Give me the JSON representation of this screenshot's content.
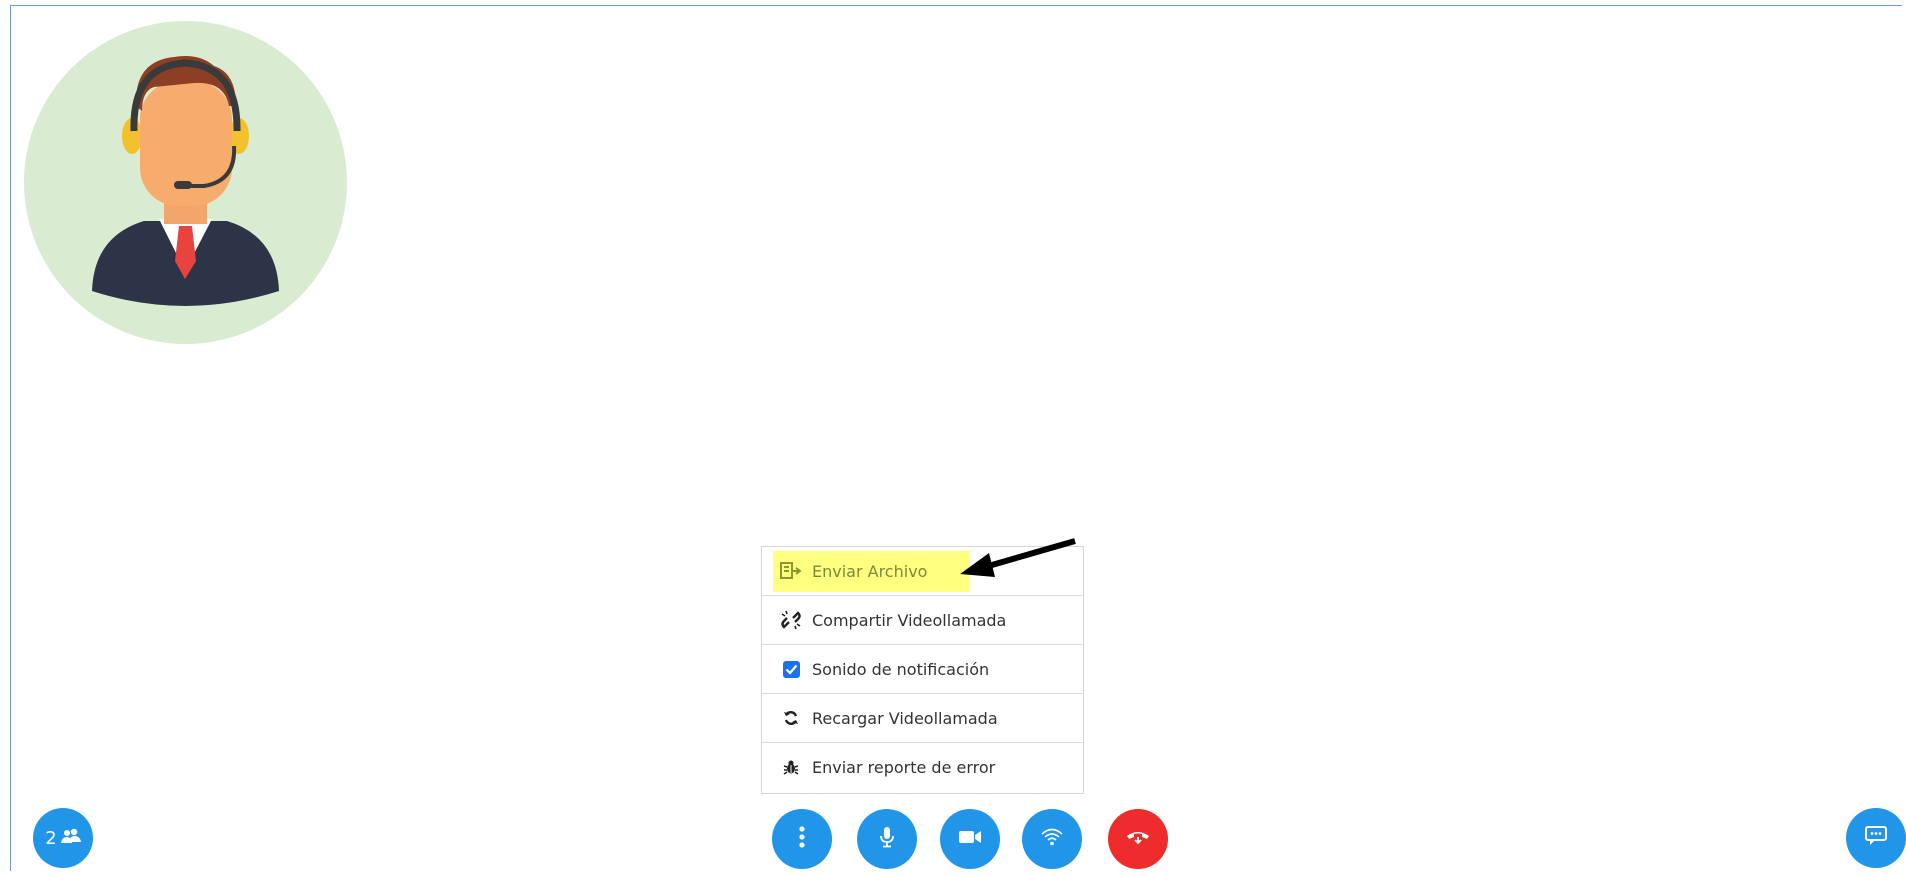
{
  "menu": {
    "items": [
      {
        "label": "Enviar Archivo",
        "icon": "send-file-icon",
        "highlighted": true
      },
      {
        "label": "Compartir Videollamada",
        "icon": "link-icon"
      },
      {
        "label": "Sonido de notificación",
        "icon": "checkbox-checked",
        "checked": true
      },
      {
        "label": "Recargar Videollamada",
        "icon": "refresh-icon"
      },
      {
        "label": "Enviar reporte de error",
        "icon": "bug-icon"
      }
    ]
  },
  "participants": {
    "count": "2",
    "icon": "users-icon"
  },
  "controls": {
    "more": "more-vertical-icon",
    "mic": "microphone-icon",
    "video": "video-camera-icon",
    "signal": "wifi-signal-icon",
    "hangup": "phone-hangup-icon",
    "chat": "chat-icon"
  },
  "colors": {
    "primary": "#2196e8",
    "danger": "#ee2c2c",
    "highlight": "#ffff80",
    "avatar_bg": "#d9ecd2"
  }
}
